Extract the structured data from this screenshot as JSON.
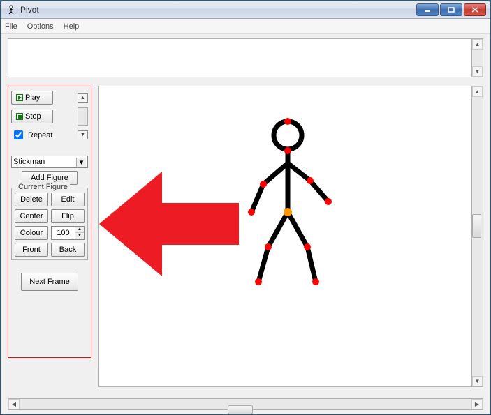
{
  "window": {
    "title": "Pivot"
  },
  "menu": {
    "file": "File",
    "options": "Options",
    "help": "Help"
  },
  "playback": {
    "play": "Play",
    "stop": "Stop",
    "repeat_label": "Repeat"
  },
  "figure_select": {
    "value": "Stickman",
    "add_figure": "Add Figure"
  },
  "current_figure": {
    "legend": "Current Figure",
    "delete": "Delete",
    "edit": "Edit",
    "center": "Center",
    "flip": "Flip",
    "colour": "Colour",
    "scale_value": "100",
    "front": "Front",
    "back": "Back"
  },
  "frame": {
    "next_frame": "Next Frame"
  },
  "colors": {
    "highlight_border": "#e01010",
    "arrow_fill": "#ed1c24",
    "joint": "#ff0000",
    "origin_joint": "#ff9900",
    "figure_stroke": "#000000"
  }
}
